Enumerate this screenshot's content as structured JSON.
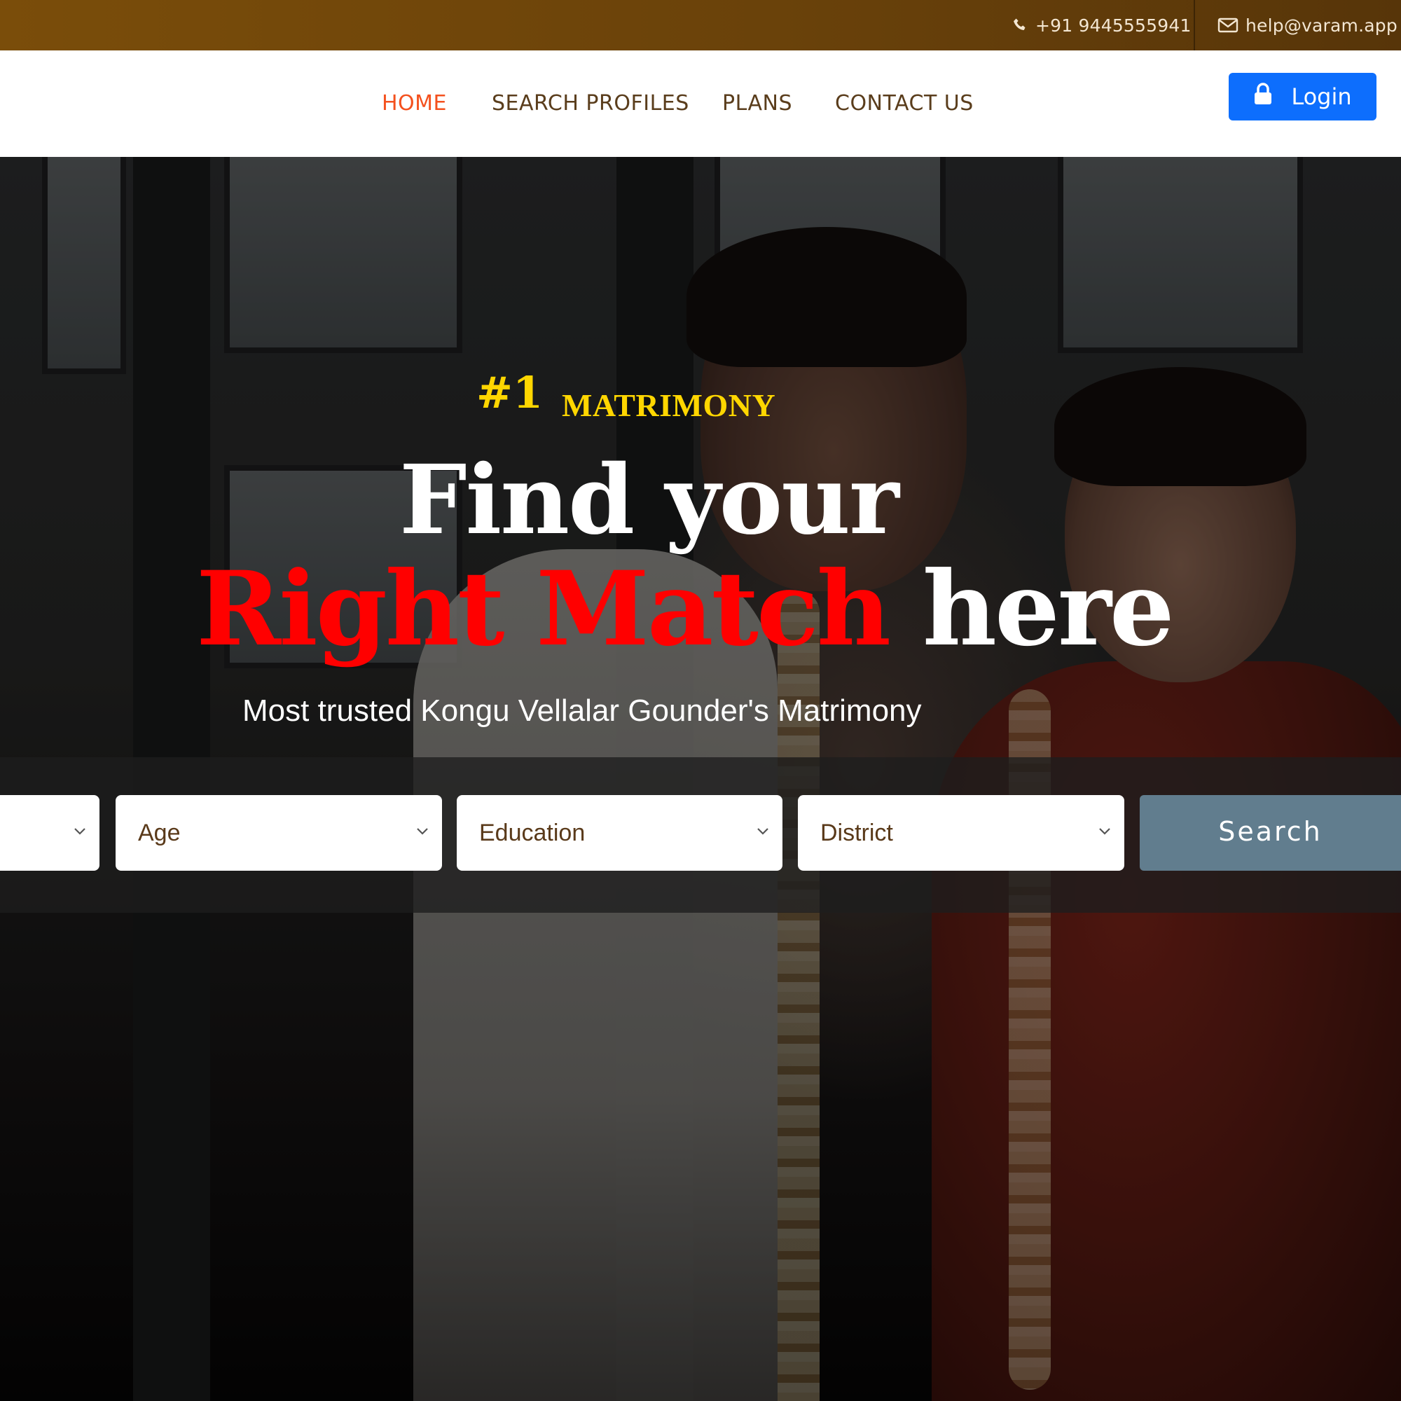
{
  "topbar": {
    "phone": "+91 9445555941",
    "email": "help@varam.app",
    "icons": [
      "phone-icon",
      "envelope-icon"
    ]
  },
  "nav": {
    "items": [
      {
        "label": "HOME",
        "active": true
      },
      {
        "label": "SEARCH PROFILES",
        "active": false
      },
      {
        "label": "PLANS",
        "active": false
      },
      {
        "label": "CONTACT US",
        "active": false
      }
    ],
    "login_label": "Login",
    "login_icon": "lock-icon"
  },
  "hero": {
    "tag_number": "#1",
    "tag_word": "MATRIMONY",
    "headline_line1": "Find your",
    "headline_red": "Right Match",
    "headline_white": "here",
    "subline": "Most trusted Kongu Vellalar Gounder's Matrimony"
  },
  "search": {
    "filters": [
      {
        "label": ""
      },
      {
        "label": "Age"
      },
      {
        "label": "Education"
      },
      {
        "label": "District"
      }
    ],
    "button_label": "Search"
  },
  "colors": {
    "topbar": "#6a420a",
    "nav_text": "#5a3d1c",
    "nav_active": "#f4511e",
    "login_button": "#0d6efd",
    "tag_yellow": "#ffd600",
    "headline_red": "#ff0000",
    "search_button": "#617d8e"
  }
}
